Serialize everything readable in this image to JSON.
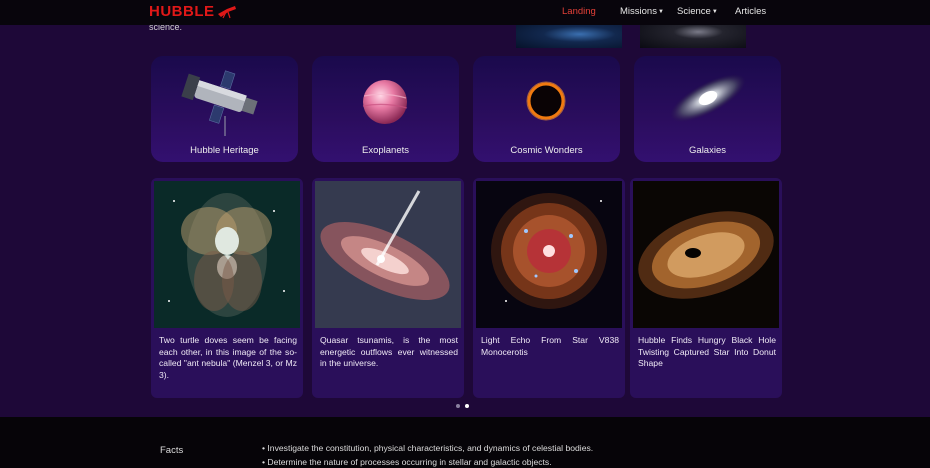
{
  "navbar": {
    "logo": "HUBBLE",
    "links": [
      {
        "label": "Landing",
        "active": true,
        "dropdown": false
      },
      {
        "label": "Missions",
        "active": false,
        "dropdown": true
      },
      {
        "label": "Science",
        "active": false,
        "dropdown": true
      },
      {
        "label": "Articles",
        "active": false,
        "dropdown": false
      }
    ]
  },
  "hero": {
    "text": "science."
  },
  "categories": [
    {
      "label": "Hubble Heritage",
      "icon": "telescope-icon"
    },
    {
      "label": "Exoplanets",
      "icon": "planet-icon"
    },
    {
      "label": "Cosmic Wonders",
      "icon": "eclipse-ring-icon"
    },
    {
      "label": "Galaxies",
      "icon": "galaxy-icon"
    }
  ],
  "stories": [
    {
      "text": "Two turtle doves seem be facing each other, in this image of the so-called \"ant nebula\" (Menzel 3, or Mz 3).",
      "image": "ant-nebula-image"
    },
    {
      "text": "Quasar tsunamis, is the most energetic outflows ever witnessed in the universe.",
      "image": "quasar-image"
    },
    {
      "text": "Light Echo From Star V838 Monocerotis",
      "image": "light-echo-image"
    },
    {
      "text": "Hubble Finds Hungry Black Hole Twisting Captured Star Into Donut Shape",
      "image": "black-hole-image"
    }
  ],
  "carousel": {
    "count": 2,
    "active": 2
  },
  "footer": {
    "facts_title": "Facts",
    "facts": [
      "Investigate the constitution, physical characteristics, and dynamics of celestial bodies.",
      "Determine the nature of processes occurring in stellar and galactic objects."
    ]
  },
  "colors": {
    "background": "#1e0838",
    "accent": "#e01818",
    "card": "#2a0f5a"
  }
}
